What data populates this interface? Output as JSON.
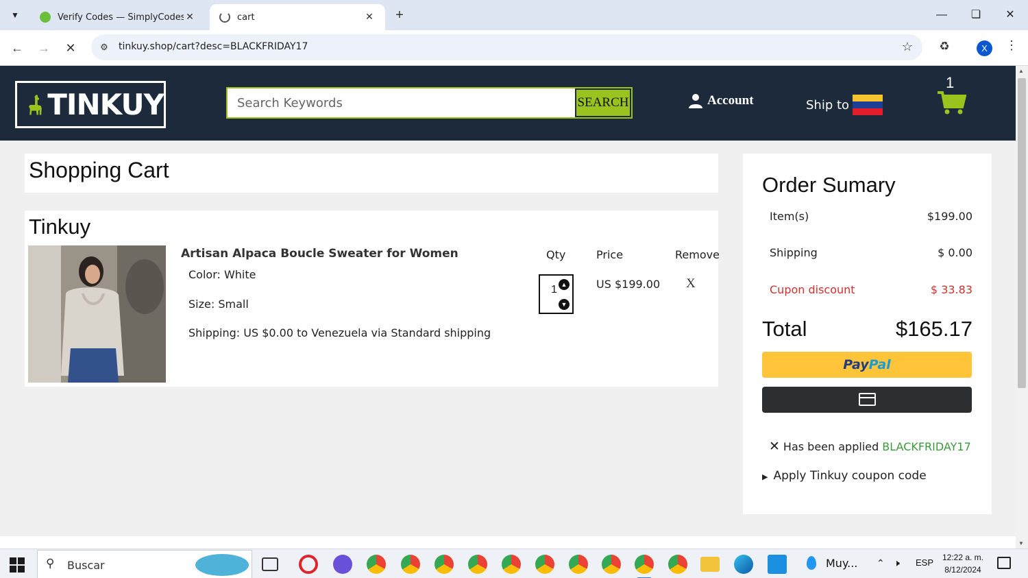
{
  "browser": {
    "tabs": [
      {
        "title": "Verify Codes — SimplyCodes",
        "active": false
      },
      {
        "title": "cart",
        "active": true
      }
    ],
    "url": "tinkuy.shop/cart?desc=BLACKFRIDAY17",
    "profile_initial": "X"
  },
  "header": {
    "logo_text": "TINKUY",
    "search_placeholder": "Search Keywords",
    "search_button": "SEARCH",
    "account_label": "Account",
    "ship_to_label": "Ship to",
    "cart_count": "1"
  },
  "cart": {
    "title": "Shopping Cart",
    "seller": "Tinkuy",
    "columns": {
      "qty": "Qty",
      "price": "Price",
      "remove": "Remove"
    },
    "item": {
      "name": "Artisan Alpaca Boucle Sweater for Women",
      "color": "Color: White",
      "size": "Size: Small",
      "shipping": "Shipping: US $0.00 to Venezuela via Standard shipping",
      "qty": "1",
      "price": "US $199.00",
      "remove": "X"
    }
  },
  "summary": {
    "title": "Order Sumary",
    "rows": [
      {
        "label": "Item(s)",
        "value": "$199.00"
      },
      {
        "label": "Shipping",
        "value": "$ 0.00"
      },
      {
        "label": "Cupon discount",
        "value": "$ 33.83"
      }
    ],
    "total_label": "Total",
    "total_value": "$165.17",
    "paypal_pay": "Pay",
    "paypal_pal": "Pal",
    "applied_text": "Has been applied",
    "applied_code": "BLACKFRIDAY17",
    "apply_coupon": "Apply Tinkuy coupon code"
  },
  "taskbar": {
    "search_text": "Buscar",
    "weather_text": "Muy...",
    "language": "ESP",
    "time": "12:22 a. m.",
    "date": "8/12/2024"
  },
  "colors": {
    "header_bg": "#1d2a3b",
    "accent_green": "#9bc31d",
    "discount_red": "#d32f2f",
    "coupon_green": "#3a9a3a",
    "paypal_yellow": "#ffc439"
  }
}
